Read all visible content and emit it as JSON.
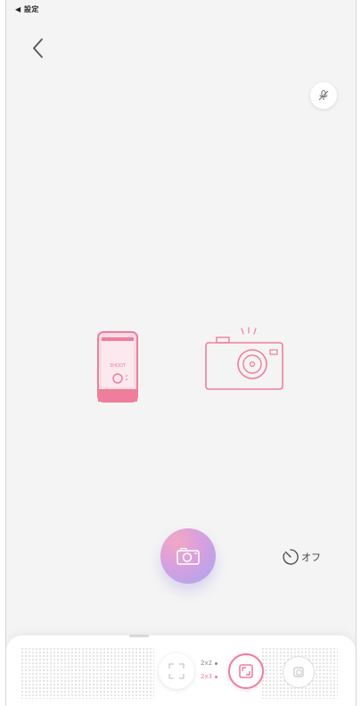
{
  "status_bar": {
    "back_app_label": "◀ 設定"
  },
  "icons": {
    "back": "chevron-left-icon",
    "mic": "mic-off-icon",
    "phone": "phone-illustration",
    "camera": "camera-illustration",
    "shutter": "camera-icon",
    "timer": "timer-icon",
    "mode_left": "frame-mode-icon",
    "mode_center": "grid-mode-icon",
    "mode_right": "copy-mode-icon"
  },
  "phone_illustration": {
    "text": "SHOOT"
  },
  "timer": {
    "label": "オフ"
  },
  "size_options": {
    "option_1": "2x2",
    "option_2": "2x3"
  },
  "colors": {
    "accent": "#ee7e9b",
    "background": "#f4f4f4",
    "shutter_gradient_start": "#f3a8c4",
    "shutter_gradient_end": "#a7a6f2"
  }
}
